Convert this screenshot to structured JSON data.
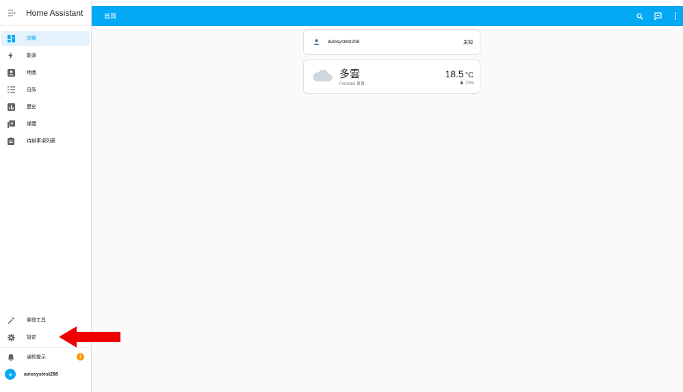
{
  "sidebar": {
    "app_title": "Home Assistant",
    "items": [
      {
        "label": "總覽",
        "icon": "dashboard-icon",
        "active": true
      },
      {
        "label": "能源",
        "icon": "lightning-icon",
        "active": false
      },
      {
        "label": "地圖",
        "icon": "account-box-icon",
        "active": false
      },
      {
        "label": "日誌",
        "icon": "list-icon",
        "active": false
      },
      {
        "label": "歷史",
        "icon": "chart-box-icon",
        "active": false
      },
      {
        "label": "媒體",
        "icon": "play-box-icon",
        "active": false
      },
      {
        "label": "待辦事項列表",
        "icon": "clipboard-list-icon",
        "active": false
      }
    ],
    "bottom": {
      "dev_tools": "開發工具",
      "settings": "設定",
      "notifications": "通知提示",
      "notification_count": "1",
      "user_initial": "a",
      "user_name": "aviosystest268"
    }
  },
  "topbar": {
    "title": "首頁",
    "actions": [
      "search-icon",
      "assist-chat-icon",
      "more-vert-icon"
    ]
  },
  "main": {
    "person_card": {
      "name": "aviosystest268",
      "state": "未知"
    },
    "weather_card": {
      "condition": "多雲",
      "subtitle": "Forecast 首頁",
      "temperature": "18.5",
      "unit": "°C",
      "humidity": "73%"
    }
  },
  "colors": {
    "primary": "#03a9f4",
    "sidebar_active_bg": "#e3f2fd",
    "badge": "#ff9800",
    "annotation_arrow": "#ee0000"
  }
}
